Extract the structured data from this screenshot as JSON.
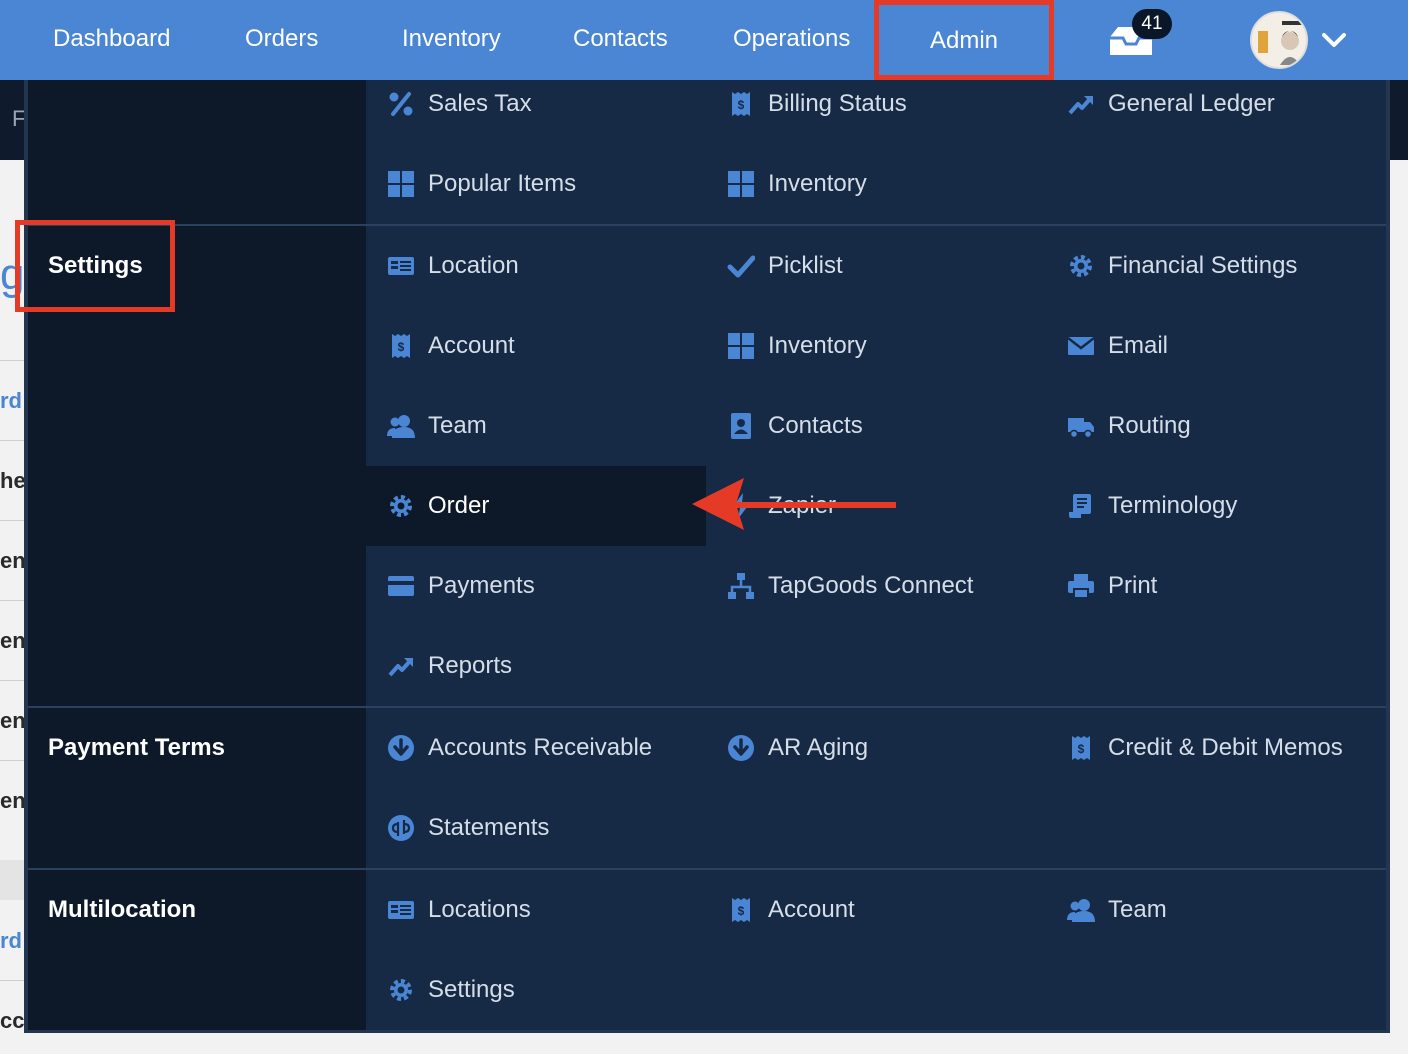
{
  "topnav": {
    "items": [
      "Dashboard",
      "Orders",
      "Inventory",
      "Contacts",
      "Operations"
    ],
    "admin": "Admin",
    "notification_count": "41"
  },
  "background_fragments": [
    "F",
    "g",
    "rd",
    "he",
    "en",
    "en",
    "en",
    "en",
    "rd",
    "cc"
  ],
  "menu": {
    "top": {
      "items": [
        {
          "label": "Sales Tax",
          "icon": "percent-icon"
        },
        {
          "label": "Billing Status",
          "icon": "receipt-icon"
        },
        {
          "label": "General Ledger",
          "icon": "trend-icon"
        },
        {
          "label": "Popular Items",
          "icon": "grid-icon"
        },
        {
          "label": "Inventory",
          "icon": "grid-icon"
        }
      ]
    },
    "settings": {
      "title": "Settings",
      "items": [
        {
          "label": "Location",
          "icon": "id-card-icon"
        },
        {
          "label": "Picklist",
          "icon": "check-icon"
        },
        {
          "label": "Financial Settings",
          "icon": "gear-icon"
        },
        {
          "label": "Account",
          "icon": "receipt-icon"
        },
        {
          "label": "Inventory",
          "icon": "grid-icon"
        },
        {
          "label": "Email",
          "icon": "envelope-icon"
        },
        {
          "label": "Team",
          "icon": "users-icon"
        },
        {
          "label": "Contacts",
          "icon": "contact-book-icon"
        },
        {
          "label": "Routing",
          "icon": "truck-icon"
        },
        {
          "label": "Order",
          "icon": "gear-icon"
        },
        {
          "label": "Zapier",
          "icon": "zap-icon"
        },
        {
          "label": "Terminology",
          "icon": "scroll-icon"
        },
        {
          "label": "Payments",
          "icon": "credit-card-icon"
        },
        {
          "label": "TapGoods Connect",
          "icon": "network-icon"
        },
        {
          "label": "Print",
          "icon": "printer-icon"
        },
        {
          "label": "Reports",
          "icon": "trend-icon"
        }
      ]
    },
    "payment_terms": {
      "title": "Payment Terms",
      "items": [
        {
          "label": "Accounts Receivable",
          "icon": "arrow-circle-down-icon"
        },
        {
          "label": "AR Aging",
          "icon": "arrow-circle-down-icon"
        },
        {
          "label": "Credit & Debit Memos",
          "icon": "receipt-icon"
        },
        {
          "label": "Statements",
          "icon": "quickbooks-icon"
        }
      ]
    },
    "multilocation": {
      "title": "Multilocation",
      "items": [
        {
          "label": "Locations",
          "icon": "id-card-icon"
        },
        {
          "label": "Account",
          "icon": "receipt-icon"
        },
        {
          "label": "Team",
          "icon": "users-icon"
        },
        {
          "label": "Settings",
          "icon": "gear-icon"
        }
      ]
    }
  },
  "colors": {
    "topbar": "#4a86d4",
    "menu_bg": "#172a45",
    "menu_left": "#0d1829",
    "icon": "#4a86d4",
    "highlight": "#e53a26"
  }
}
